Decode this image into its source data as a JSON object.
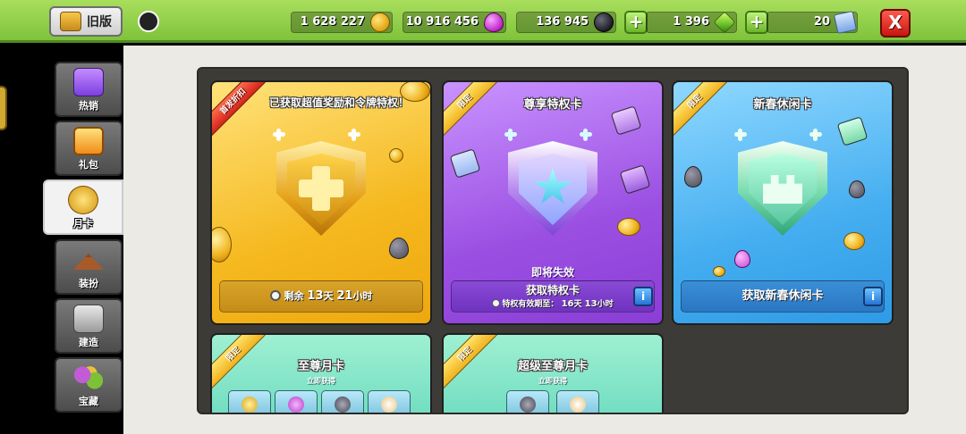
{
  "topbar": {
    "old_version_label": "旧版",
    "resources": [
      {
        "name": "gold",
        "value": "1 628 227",
        "icon": "gold-coin-icon"
      },
      {
        "name": "elixir",
        "value": "10 916 456",
        "icon": "elixir-drop-icon"
      },
      {
        "name": "dark_elixir",
        "value": "136 945",
        "icon": "dark-elixir-icon"
      },
      {
        "name": "gems",
        "value": "1 396",
        "icon": "gem-icon"
      },
      {
        "name": "tickets",
        "value": "20",
        "icon": "ticket-icon"
      }
    ],
    "plus_symbol": "+",
    "close_symbol": "X"
  },
  "sidebar": {
    "items": [
      {
        "label": "热销",
        "icon": "hot-deals-icon"
      },
      {
        "label": "礼包",
        "icon": "gift-box-icon"
      },
      {
        "label": "月卡",
        "icon": "month-pass-icon"
      },
      {
        "label": "装扮",
        "icon": "hanger-icon"
      },
      {
        "label": "建造",
        "icon": "hammer-icon"
      },
      {
        "label": "宝藏",
        "icon": "treasure-icon"
      }
    ],
    "active_index": 2
  },
  "cards": {
    "gold_pass": {
      "ribbon": "首发折扣",
      "title": "已获取超值奖励和令牌特权！",
      "timer_prefix": "剩余",
      "days": "13",
      "days_unit": "天",
      "hours": "21",
      "hours_unit": "小时"
    },
    "premium_pass": {
      "ribbon": "限定",
      "title": "尊享特权卡",
      "expiring": "即将失效",
      "action": "获取特权卡",
      "validity_prefix": "特权有效期至：",
      "days": "16",
      "days_unit": "天",
      "hours": "13",
      "hours_unit": "小时",
      "info": "i"
    },
    "spring_pass": {
      "ribbon": "限定",
      "title": "新春休闲卡",
      "action": "获取新春休闲卡",
      "info": "i"
    },
    "supreme_month": {
      "ribbon": "限定",
      "title": "至尊月卡",
      "subtitle": "立即获得"
    },
    "super_supreme_month": {
      "ribbon": "限定",
      "title": "超级至尊月卡",
      "subtitle": "立即获得"
    }
  },
  "colors": {
    "topbar_green": "#8fd047",
    "gold_card": "#f7c234",
    "purple_card": "#a95be8",
    "blue_card": "#4fb6f2",
    "teal_card": "#7fe3c0",
    "panel_dark": "#3d3b37"
  }
}
